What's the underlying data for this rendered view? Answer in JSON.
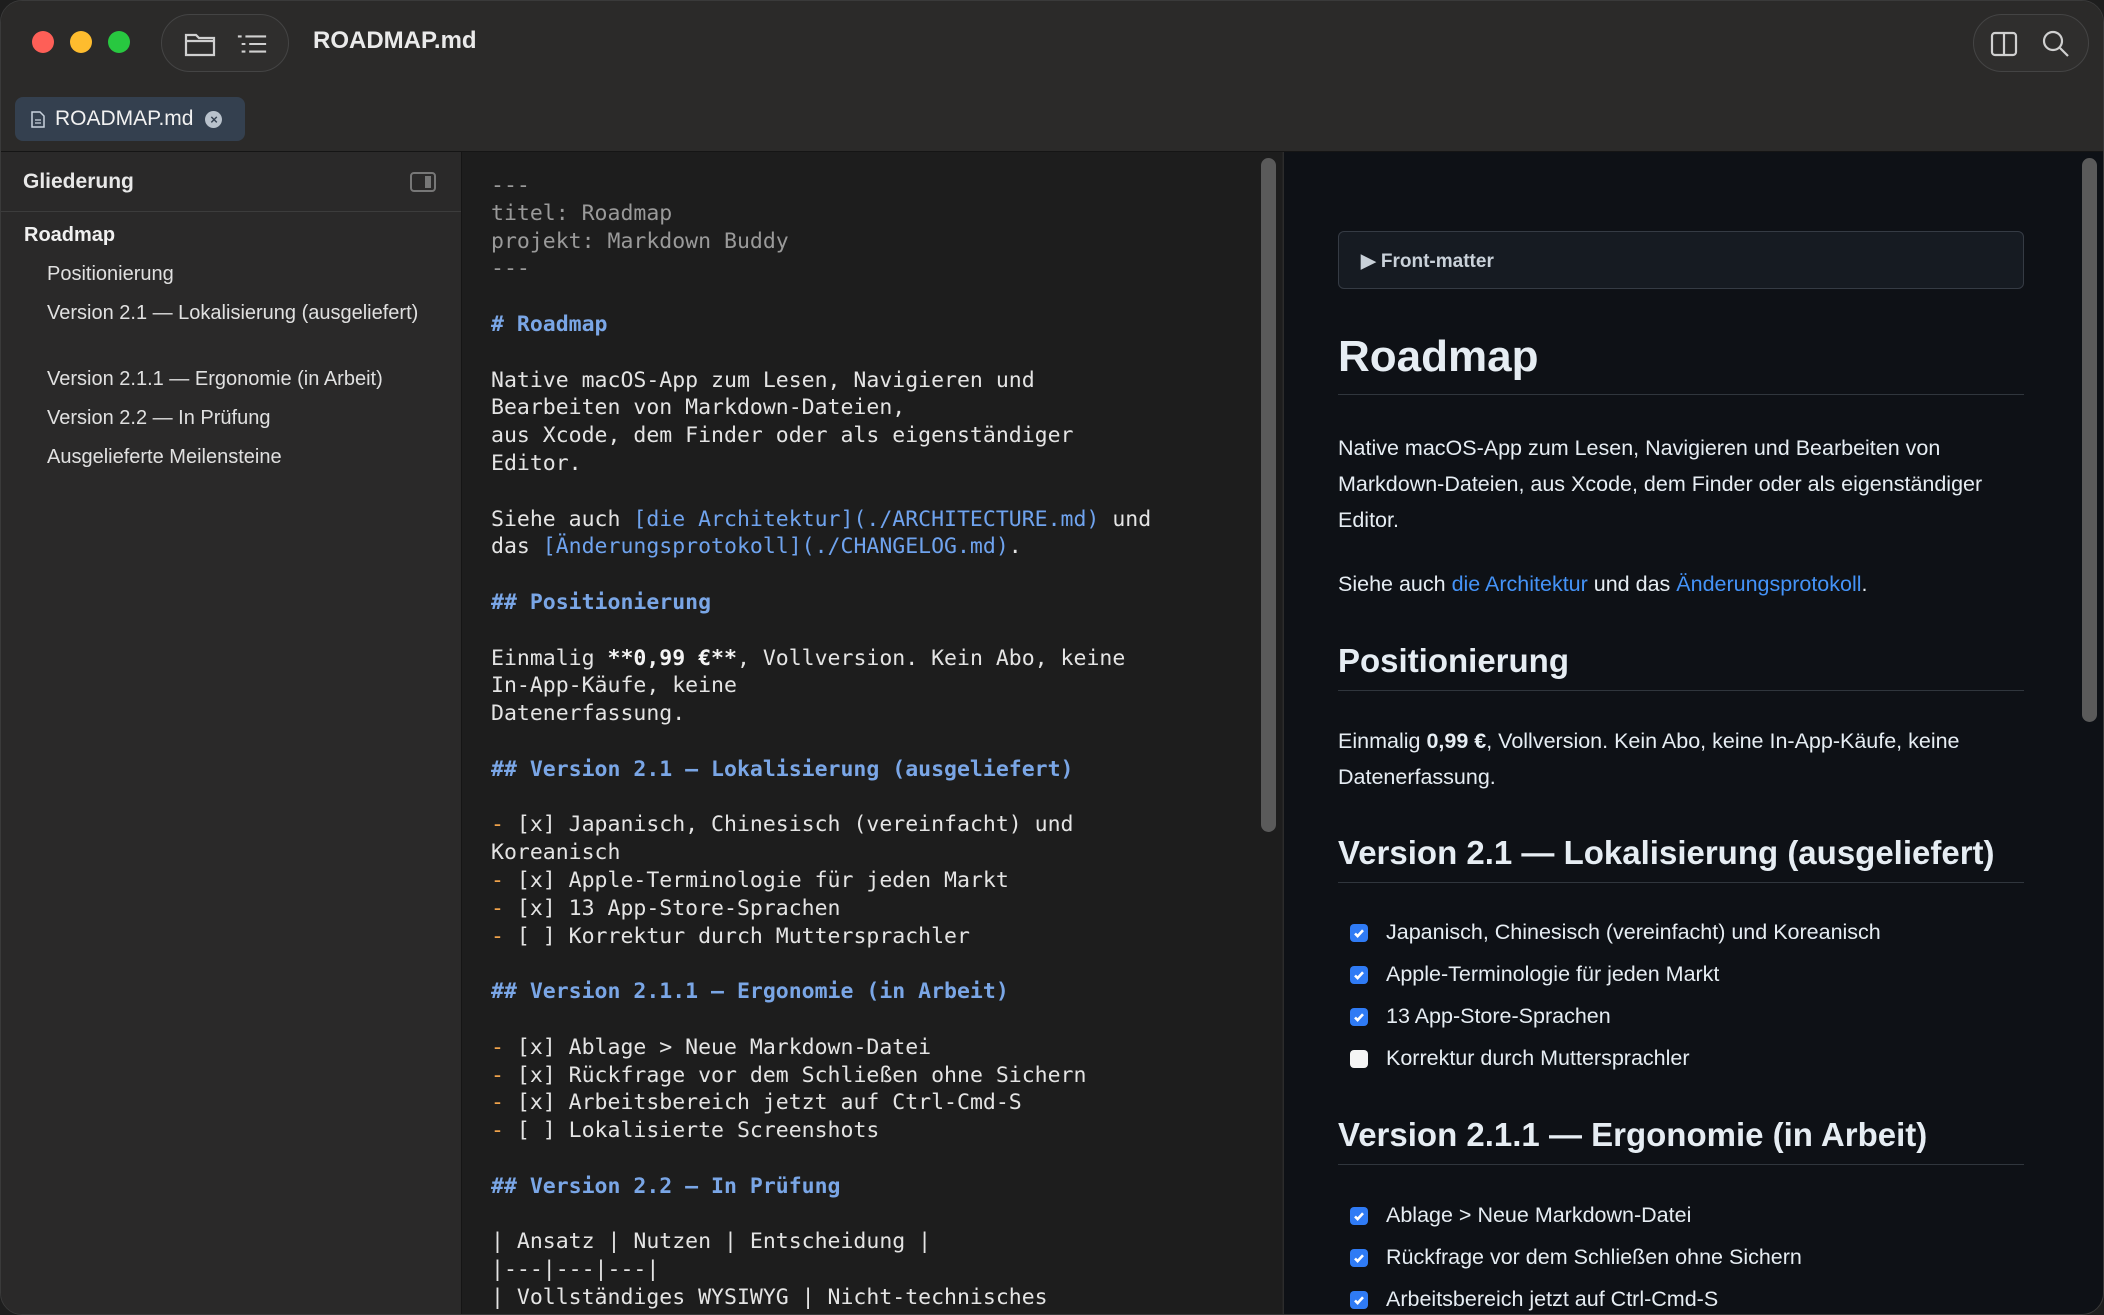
{
  "window": {
    "title": "ROADMAP.md"
  },
  "toolbar": {
    "open_icon": "folder-icon",
    "outline_icon": "list-icon",
    "split_icon": "split-view-icon",
    "search_icon": "search-icon"
  },
  "tab": {
    "label": "ROADMAP.md"
  },
  "sidebar": {
    "header": "Gliederung",
    "items": [
      {
        "label": "Roadmap",
        "level": 1
      },
      {
        "label": "Positionierung",
        "level": 2
      },
      {
        "label": "Version 2.1 — Lokalisierung (ausgeliefert)",
        "level": 2
      },
      {
        "label": "Version 2.1.1 — Ergonomie (in Arbeit)",
        "level": 2
      },
      {
        "label": "Version 2.2 — In Prüfung",
        "level": 2
      },
      {
        "label": "Ausgelieferte Meilensteine",
        "level": 2
      }
    ]
  },
  "editor": {
    "lines": [
      "---",
      "titel: Roadmap",
      "projekt: Markdown Buddy",
      "---",
      "",
      "# Roadmap",
      "",
      "Native macOS-App zum Lesen, Navigieren und",
      "Bearbeiten von Markdown-Dateien,",
      "aus Xcode, dem Finder oder als eigenständiger",
      "Editor.",
      "",
      "Siehe auch [die Architektur](./ARCHITECTURE.md) und",
      "das [Änderungsprotokoll](./CHANGELOG.md).",
      "",
      "## Positionierung",
      "",
      "Einmalig **0,99 €**, Vollversion. Kein Abo, keine",
      "In-App-Käufe, keine",
      "Datenerfassung.",
      "",
      "## Version 2.1 — Lokalisierung (ausgeliefert)",
      "",
      "- [x] Japanisch, Chinesisch (vereinfacht) und",
      "Koreanisch",
      "- [x] Apple-Terminologie für jeden Markt",
      "- [x] 13 App-Store-Sprachen",
      "- [ ] Korrektur durch Muttersprachler",
      "",
      "## Version 2.1.1 — Ergonomie (in Arbeit)",
      "",
      "- [x] Ablage > Neue Markdown-Datei",
      "- [x] Rückfrage vor dem Schließen ohne Sichern",
      "- [x] Arbeitsbereich jetzt auf Ctrl-Cmd-S",
      "- [ ] Lokalisierte Screenshots",
      "",
      "## Version 2.2 — In Prüfung",
      "",
      "| Ansatz | Nutzen | Entscheidung |",
      "|---|---|---|",
      "| Vollständiges WYSIWYG | Nicht-technisches"
    ]
  },
  "preview": {
    "front_matter": "▶ Front-matter",
    "title": "Roadmap",
    "intro": "Native macOS-App zum Lesen, Navigieren und Bearbeiten von Markdown-Dateien, aus Xcode, dem Finder oder als eigenständiger Editor.",
    "see_also": {
      "prefix": "Siehe auch ",
      "link1": "die Architektur",
      "middle": " und das ",
      "link2": "Änderungsprotokoll",
      "suffix": "."
    },
    "positioning": {
      "heading": "Positionierung",
      "prefix": "Einmalig ",
      "bold": "0,99 €",
      "rest": ", Vollversion. Kein Abo, keine In-App-Käufe, keine Datenerfassung."
    },
    "v21": {
      "heading": "Version 2.1 — Lokalisierung (ausgeliefert)",
      "tasks": [
        {
          "label": "Japanisch, Chinesisch (vereinfacht) und Koreanisch",
          "done": true
        },
        {
          "label": "Apple-Terminologie für jeden Markt",
          "done": true
        },
        {
          "label": "13 App-Store-Sprachen",
          "done": true
        },
        {
          "label": "Korrektur durch Muttersprachler",
          "done": false
        }
      ]
    },
    "v211": {
      "heading": "Version 2.1.1 — Ergonomie (in Arbeit)",
      "tasks": [
        {
          "label": "Ablage > Neue Markdown-Datei",
          "done": true
        },
        {
          "label": "Rückfrage vor dem Schließen ohne Sichern",
          "done": true
        },
        {
          "label": "Arbeitsbereich jetzt auf Ctrl-Cmd-S",
          "done": true
        }
      ]
    }
  }
}
